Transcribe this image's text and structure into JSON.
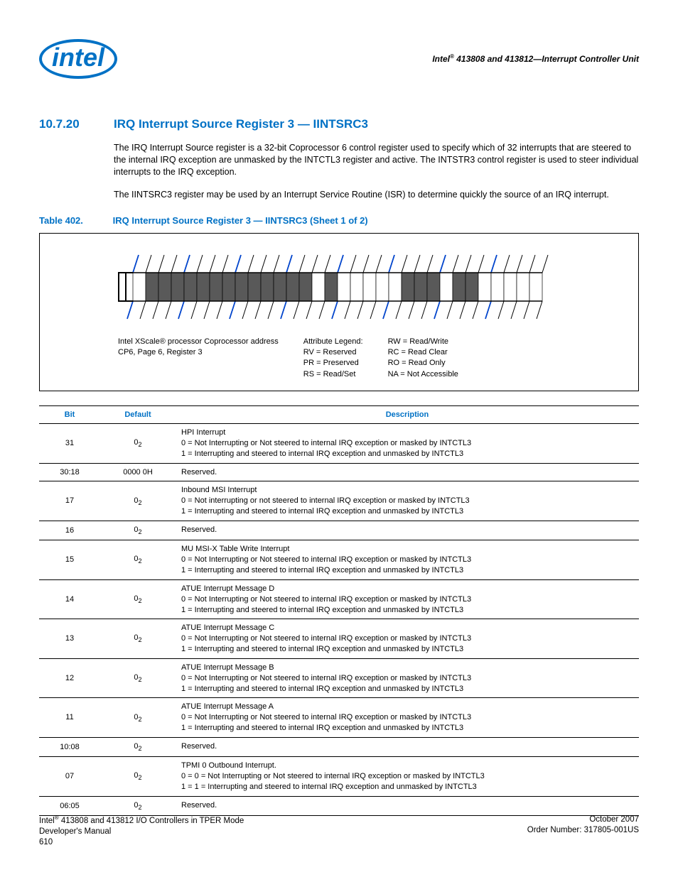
{
  "header": {
    "logo_text": "intel",
    "title_prefix": "Intel",
    "title_rest": " 413808 and 413812—Interrupt Controller Unit"
  },
  "section": {
    "number": "10.7.20",
    "title": "IRQ Interrupt Source Register 3 — IINTSRC3",
    "para1": "The IRQ Interrupt Source register is a 32-bit Coprocessor 6 control register used to specify which of 32 interrupts that are steered to the internal IRQ exception are unmasked by the INTCTL3 register and active. The INTSTR3 control register is used to steer individual interrupts to the IRQ exception.",
    "para2": "The IINTSRC3 register may be used by an Interrupt Service Routine (ISR) to determine quickly the source of an IRQ interrupt."
  },
  "table_caption": {
    "label": "Table 402.",
    "text": "IRQ Interrupt Source Register 3 — IINTSRC3 (Sheet 1 of 2)"
  },
  "legend": {
    "coproc1": "Intel XScale® processor Coprocessor address",
    "coproc2": "CP6, Page 6, Register 3",
    "attr_head": "Attribute Legend:",
    "rv": "RV = Reserved",
    "pr": "PR = Preserved",
    "rs": "RS = Read/Set",
    "rw": "RW = Read/Write",
    "rc": "RC = Read Clear",
    "ro": "RO = Read Only",
    "na": "NA = Not Accessible"
  },
  "columns": {
    "bit": "Bit",
    "default": "Default",
    "description": "Description"
  },
  "rows": [
    {
      "bit": "31",
      "default": "0",
      "default_sub": "2",
      "lines": [
        "HPI Interrupt",
        "0 =  Not Interrupting or Not steered to internal IRQ exception or masked by INTCTL3",
        "1 =  Interrupting and steered to internal IRQ exception and unmasked by INTCTL3"
      ]
    },
    {
      "bit": "30:18",
      "default": "0000 0H",
      "lines": [
        "Reserved."
      ]
    },
    {
      "bit": "17",
      "default": "0",
      "default_sub": "2",
      "lines": [
        "Inbound MSI Interrupt",
        "0 =  Not interrupting or not steered to internal IRQ exception or masked by INTCTL3",
        "1 =  Interrupting and steered to internal IRQ exception and unmasked by INTCTL3"
      ]
    },
    {
      "bit": "16",
      "default": "0",
      "default_sub": "2",
      "lines": [
        "Reserved."
      ]
    },
    {
      "bit": "15",
      "default": "0",
      "default_sub": "2",
      "lines": [
        "MU MSI-X Table Write Interrupt",
        "0 =  Not Interrupting or Not steered to internal IRQ exception or masked by INTCTL3",
        "1 =  Interrupting and steered to internal IRQ exception and unmasked by INTCTL3"
      ]
    },
    {
      "bit": "14",
      "default": "0",
      "default_sub": "2",
      "lines": [
        "ATUE Interrupt Message D",
        "0 =  Not Interrupting or Not steered to internal IRQ exception or masked by INTCTL3",
        "1 =  Interrupting and steered to internal IRQ exception and unmasked by INTCTL3"
      ]
    },
    {
      "bit": "13",
      "default": "0",
      "default_sub": "2",
      "lines": [
        "ATUE Interrupt Message C",
        "0 =  Not Interrupting or Not steered to internal IRQ exception or masked by INTCTL3",
        "1 =  Interrupting and steered to internal IRQ exception and unmasked by INTCTL3"
      ]
    },
    {
      "bit": "12",
      "default": "0",
      "default_sub": "2",
      "lines": [
        "ATUE Interrupt Message B",
        "0 =  Not Interrupting or Not steered to internal IRQ exception or masked by INTCTL3",
        "1 =  Interrupting and steered to internal IRQ exception and unmasked by INTCTL3"
      ]
    },
    {
      "bit": "11",
      "default": "0",
      "default_sub": "2",
      "lines": [
        "ATUE Interrupt Message A",
        "0 =  Not Interrupting or Not steered to internal IRQ exception or masked by INTCTL3",
        "1 =  Interrupting and steered to internal IRQ exception and unmasked by INTCTL3"
      ]
    },
    {
      "bit": "10:08",
      "default": "0",
      "default_sub": "2",
      "lines": [
        "Reserved."
      ]
    },
    {
      "bit": "07",
      "default": "0",
      "default_sub": "2",
      "lines": [
        "TPMI 0 Outbound Interrupt.",
        "0 =  0 = Not Interrupting or Not steered to internal IRQ exception or masked by INTCTL3",
        "1 =  1 = Interrupting and steered to internal IRQ exception and unmasked by INTCTL3"
      ]
    },
    {
      "bit": "06:05",
      "default": "0",
      "default_sub": "2",
      "lines": [
        "Reserved."
      ]
    }
  ],
  "footer": {
    "left1": "Intel® 413808 and 413812 I/O Controllers in TPER Mode",
    "left2": "Developer's Manual",
    "left3": "610",
    "right1": "October 2007",
    "right2": "Order Number: 317805-001US"
  },
  "bit_diagram": {
    "reserved_bits": [
      30,
      29,
      28,
      27,
      26,
      25,
      24,
      23,
      22,
      21,
      20,
      19,
      18,
      16,
      10,
      9,
      8,
      6,
      5
    ]
  }
}
